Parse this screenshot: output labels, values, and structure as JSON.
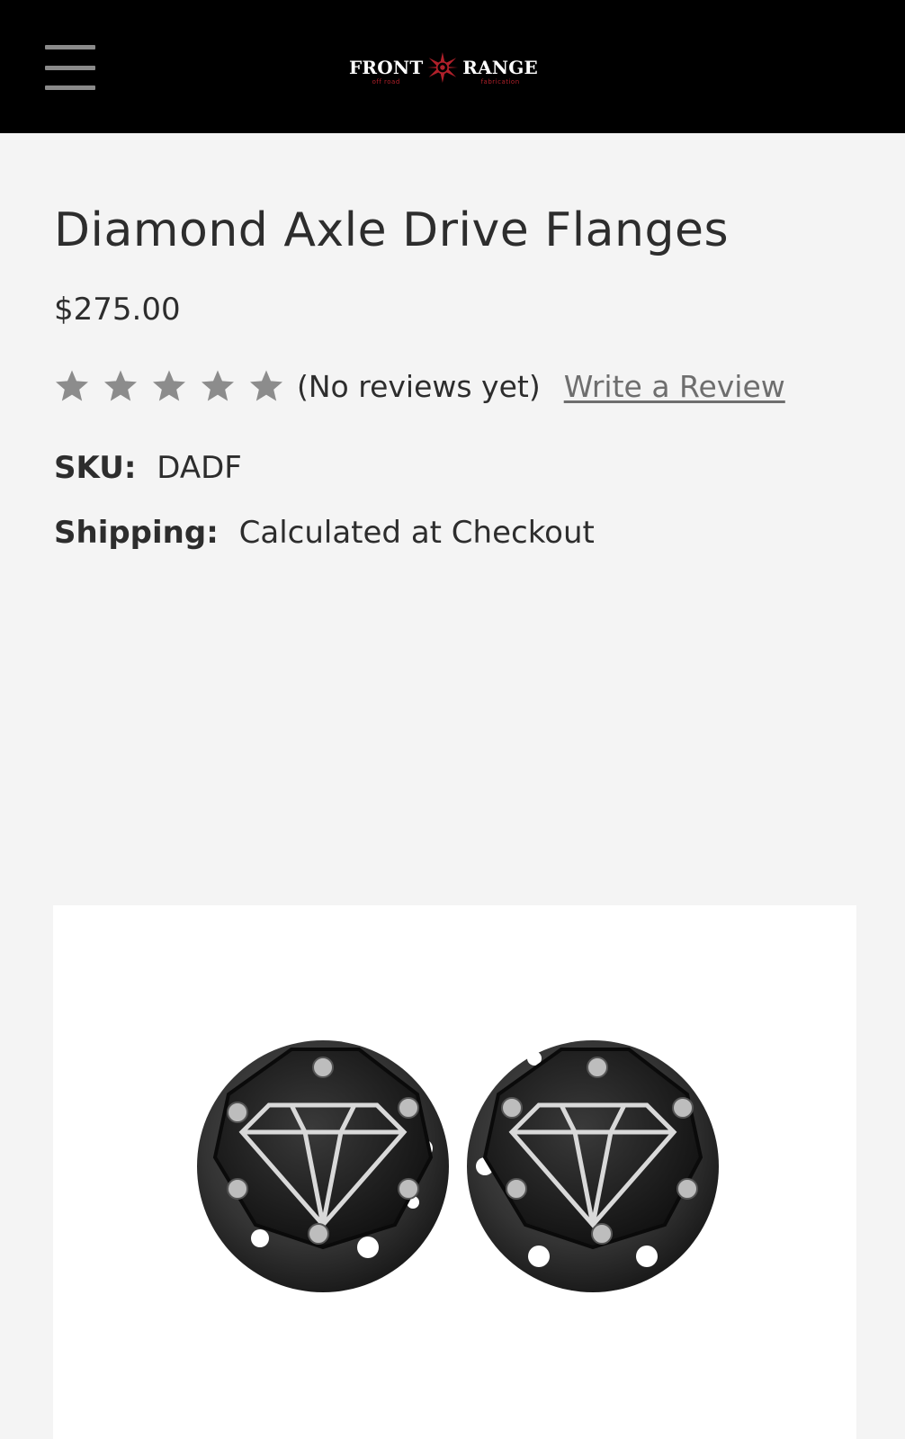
{
  "header": {
    "menu_icon": "hamburger-menu-icon",
    "logo": {
      "word_left": "FRONT",
      "word_right": "RANGE",
      "sub_left": "off road",
      "sub_right": "fabrication",
      "star_icon": "compass-star-icon",
      "accent_color": "#b0202a"
    },
    "background": "#000000"
  },
  "product": {
    "title": "Diamond Axle Drive Flanges",
    "price": "$275.00",
    "rating": {
      "stars_filled": 0,
      "stars_total": 5,
      "reviews_label": "(No reviews yet)",
      "write_review_label": "Write a Review",
      "star_color": "#8c8c8c"
    },
    "sku_label": "SKU:",
    "sku_value": "DADF",
    "shipping_label": "Shipping:",
    "shipping_value": "Calculated at Checkout",
    "image_alt": "Two black axle drive flanges engraved with diamond logos"
  }
}
